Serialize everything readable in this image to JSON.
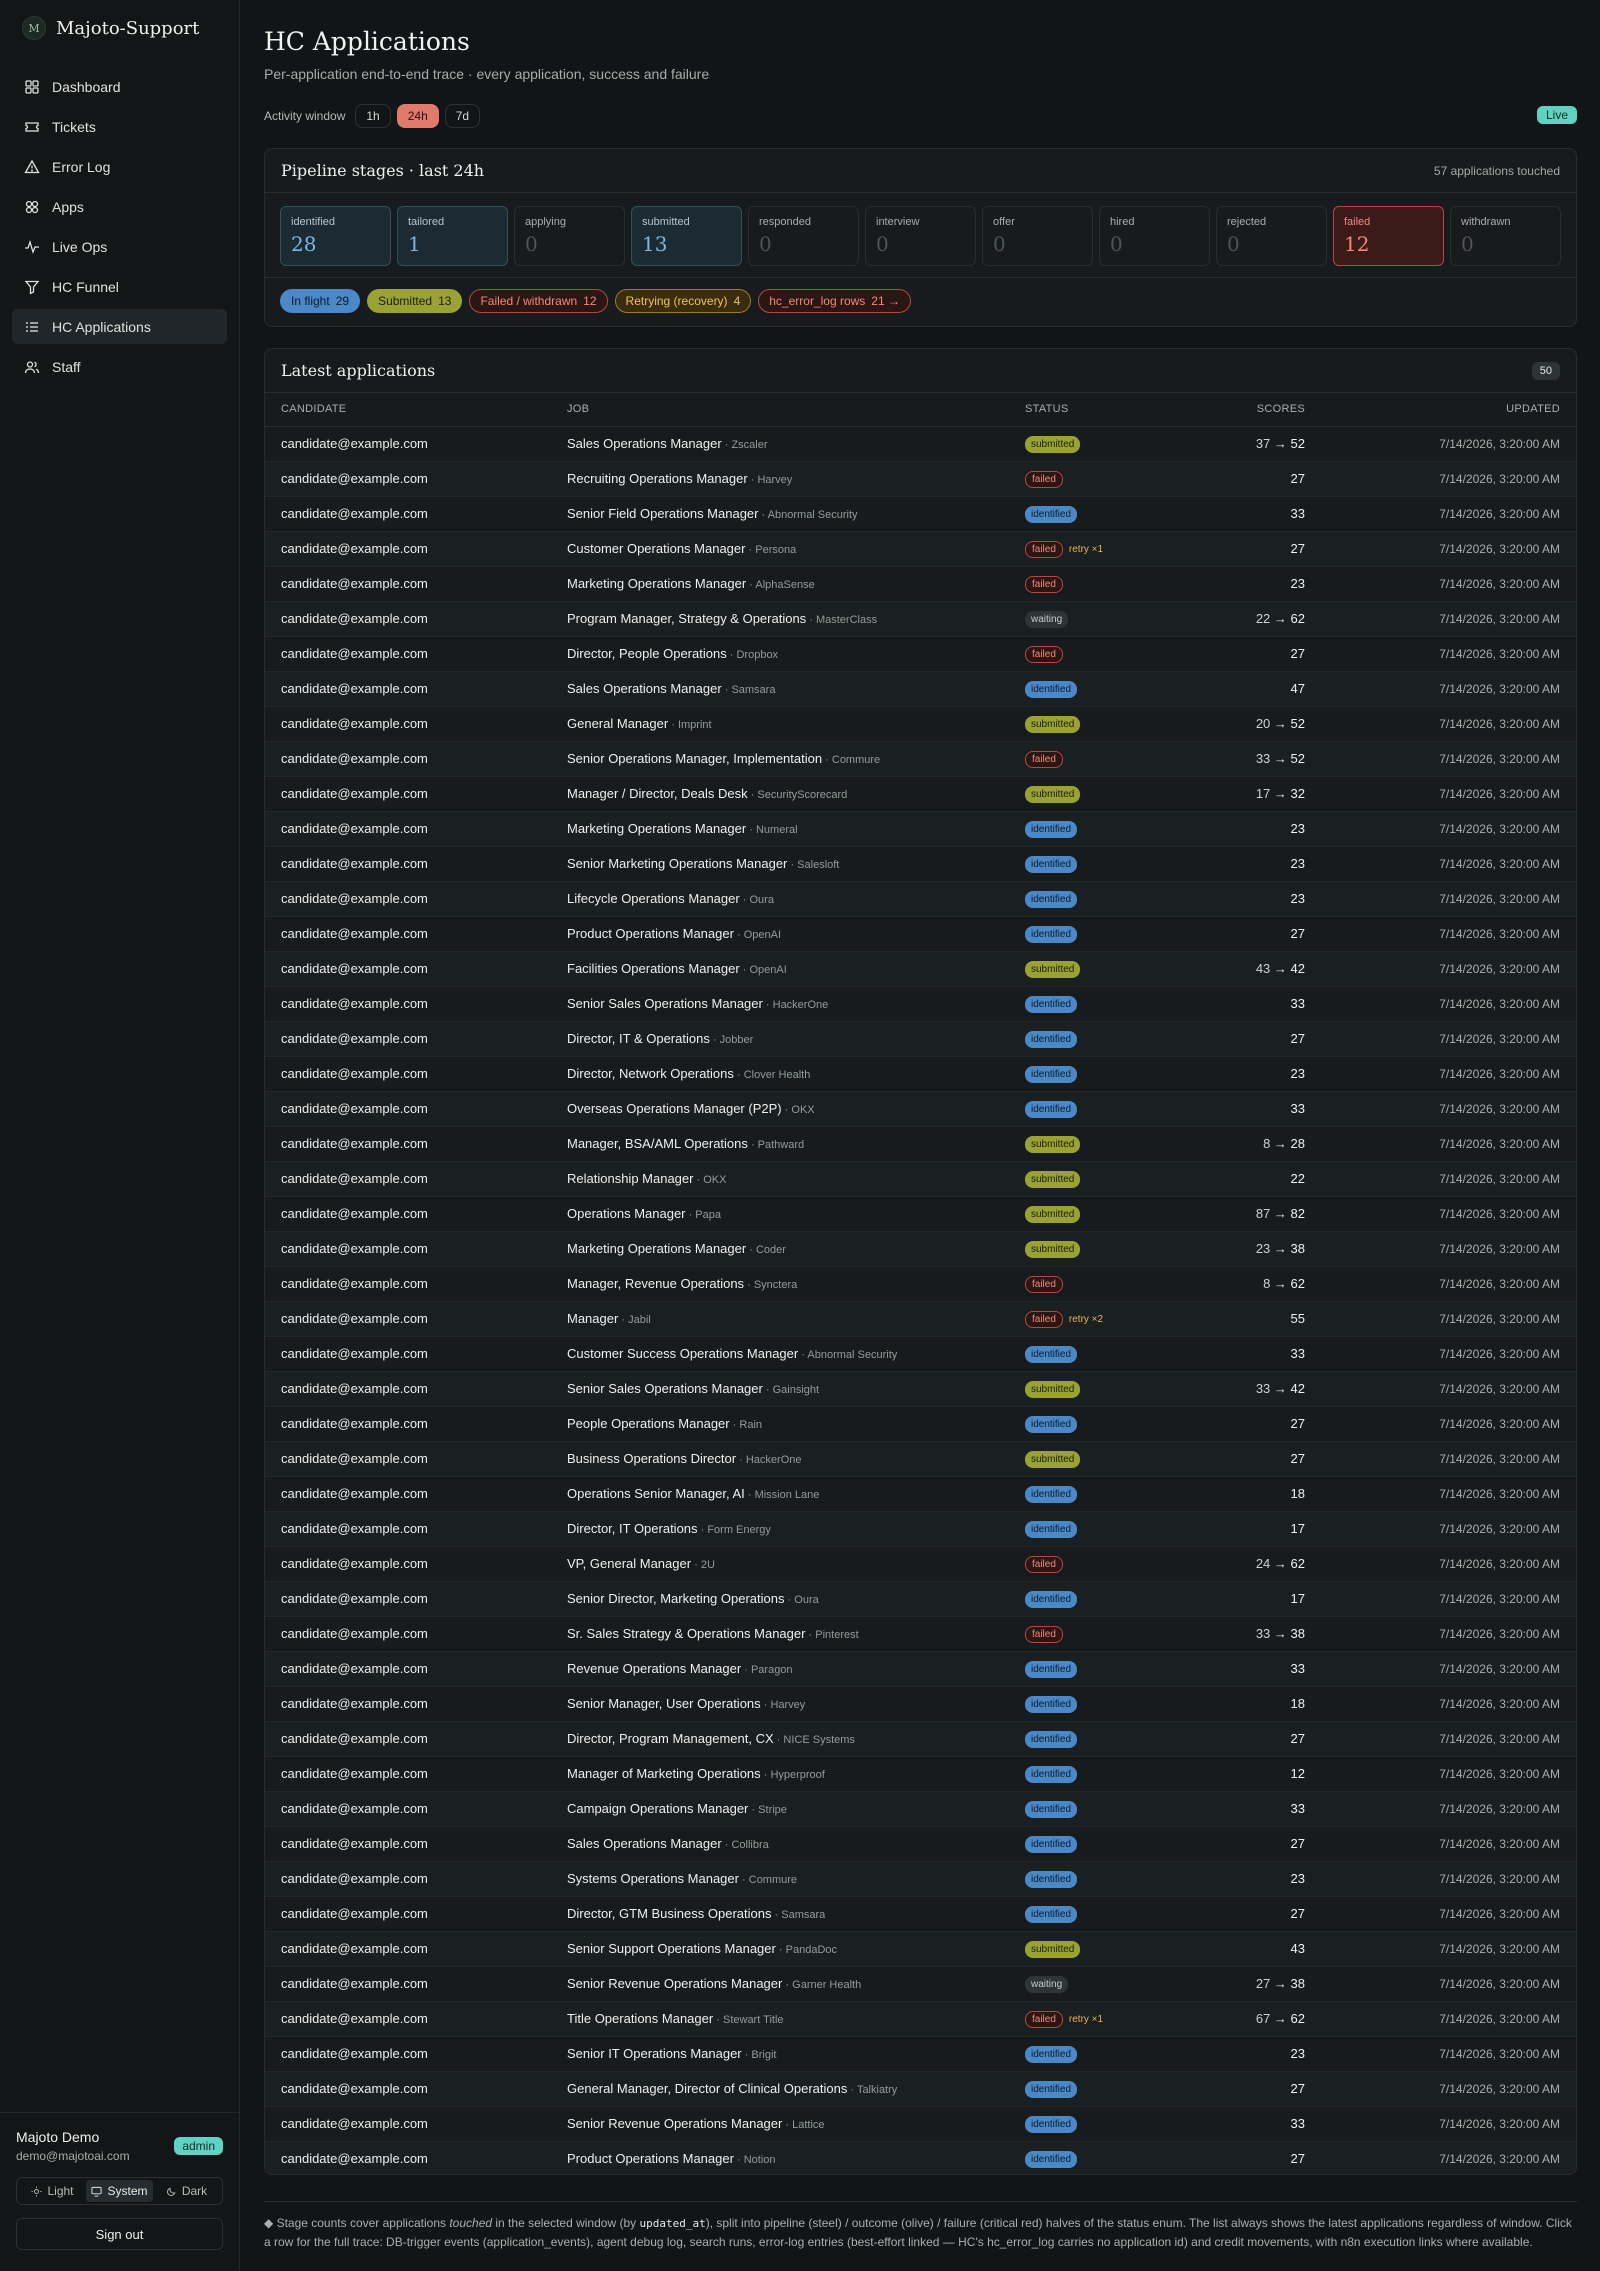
{
  "brand": {
    "logo_text": "M",
    "name": "Majoto-Support"
  },
  "nav": [
    {
      "label": "Dashboard",
      "icon": "dashboard-icon",
      "active": false
    },
    {
      "label": "Tickets",
      "icon": "ticket-icon",
      "active": false
    },
    {
      "label": "Error Log",
      "icon": "warning-icon",
      "active": false
    },
    {
      "label": "Apps",
      "icon": "apps-icon",
      "active": false
    },
    {
      "label": "Live Ops",
      "icon": "activity-icon",
      "active": false
    },
    {
      "label": "HC Funnel",
      "icon": "funnel-icon",
      "active": false
    },
    {
      "label": "HC Applications",
      "icon": "list-icon",
      "active": true
    },
    {
      "label": "Staff",
      "icon": "users-icon",
      "active": false
    }
  ],
  "user": {
    "name": "Majoto Demo",
    "email": "demo@majotoai.com",
    "role": "admin"
  },
  "theme": {
    "options": [
      "Light",
      "System",
      "Dark"
    ],
    "selected": "System"
  },
  "signout_label": "Sign out",
  "header": {
    "title": "HC Applications",
    "subtitle": "Per-application end-to-end trace · every application, success and failure",
    "window_label": "Activity window",
    "windows": [
      "1h",
      "24h",
      "7d"
    ],
    "window_selected": "24h",
    "live_label": "Live"
  },
  "pipeline": {
    "title": "Pipeline stages · last 24h",
    "meta": "57 applications touched",
    "stages": [
      {
        "label": "identified",
        "count": "28",
        "tone": "steel"
      },
      {
        "label": "tailored",
        "count": "1",
        "tone": "steel"
      },
      {
        "label": "applying",
        "count": "0",
        "tone": "muted"
      },
      {
        "label": "submitted",
        "count": "13",
        "tone": "steel"
      },
      {
        "label": "responded",
        "count": "0",
        "tone": "muted"
      },
      {
        "label": "interview",
        "count": "0",
        "tone": "muted"
      },
      {
        "label": "offer",
        "count": "0",
        "tone": "muted"
      },
      {
        "label": "hired",
        "count": "0",
        "tone": "muted"
      },
      {
        "label": "rejected",
        "count": "0",
        "tone": "muted"
      },
      {
        "label": "failed",
        "count": "12",
        "tone": "crit"
      },
      {
        "label": "withdrawn",
        "count": "0",
        "tone": "muted"
      }
    ],
    "chips": [
      {
        "label": "In flight",
        "count": "29",
        "tone": "blue"
      },
      {
        "label": "Submitted",
        "count": "13",
        "tone": "olive"
      },
      {
        "label": "Failed / withdrawn",
        "count": "12",
        "tone": "red"
      },
      {
        "label": "Retrying (recovery)",
        "count": "4",
        "tone": "amber"
      },
      {
        "label": "hc_error_log rows",
        "count": "21 →",
        "tone": "redlink"
      }
    ]
  },
  "applications": {
    "title": "Latest applications",
    "count": "50",
    "columns": [
      "CANDIDATE",
      "JOB",
      "STATUS",
      "SCORES",
      "UPDATED"
    ],
    "rows": [
      {
        "candidate": "candidate@example.com",
        "job": "Sales Operations Manager",
        "company": "Zscaler",
        "status": "submitted",
        "retry": "",
        "score_old": "37",
        "score_new": "52",
        "updated": "7/14/2026, 3:20:00 AM"
      },
      {
        "candidate": "candidate@example.com",
        "job": "Recruiting Operations Manager",
        "company": "Harvey",
        "status": "failed",
        "retry": "",
        "score_old": "",
        "score_new": "27",
        "updated": "7/14/2026, 3:20:00 AM"
      },
      {
        "candidate": "candidate@example.com",
        "job": "Senior Field Operations Manager",
        "company": "Abnormal Security",
        "status": "identified",
        "retry": "",
        "score_old": "",
        "score_new": "33",
        "updated": "7/14/2026, 3:20:00 AM"
      },
      {
        "candidate": "candidate@example.com",
        "job": "Customer Operations Manager",
        "company": "Persona",
        "status": "failed",
        "retry": "retry ×1",
        "score_old": "",
        "score_new": "27",
        "updated": "7/14/2026, 3:20:00 AM"
      },
      {
        "candidate": "candidate@example.com",
        "job": "Marketing Operations Manager",
        "company": "AlphaSense",
        "status": "failed",
        "retry": "",
        "score_old": "",
        "score_new": "23",
        "updated": "7/14/2026, 3:20:00 AM"
      },
      {
        "candidate": "candidate@example.com",
        "job": "Program Manager, Strategy & Operations",
        "company": "MasterClass",
        "status": "waiting",
        "retry": "",
        "score_old": "22",
        "score_new": "62",
        "updated": "7/14/2026, 3:20:00 AM"
      },
      {
        "candidate": "candidate@example.com",
        "job": "Director, People Operations",
        "company": "Dropbox",
        "status": "failed",
        "retry": "",
        "score_old": "",
        "score_new": "27",
        "updated": "7/14/2026, 3:20:00 AM"
      },
      {
        "candidate": "candidate@example.com",
        "job": "Sales Operations Manager",
        "company": "Samsara",
        "status": "identified",
        "retry": "",
        "score_old": "",
        "score_new": "47",
        "updated": "7/14/2026, 3:20:00 AM"
      },
      {
        "candidate": "candidate@example.com",
        "job": "General Manager",
        "company": "Imprint",
        "status": "submitted",
        "retry": "",
        "score_old": "20",
        "score_new": "52",
        "updated": "7/14/2026, 3:20:00 AM"
      },
      {
        "candidate": "candidate@example.com",
        "job": "Senior Operations Manager, Implementation",
        "company": "Commure",
        "status": "failed",
        "retry": "",
        "score_old": "33",
        "score_new": "52",
        "updated": "7/14/2026, 3:20:00 AM"
      },
      {
        "candidate": "candidate@example.com",
        "job": "Manager / Director, Deals Desk",
        "company": "SecurityScorecard",
        "status": "submitted",
        "retry": "",
        "score_old": "17",
        "score_new": "32",
        "updated": "7/14/2026, 3:20:00 AM"
      },
      {
        "candidate": "candidate@example.com",
        "job": "Marketing Operations Manager",
        "company": "Numeral",
        "status": "identified",
        "retry": "",
        "score_old": "",
        "score_new": "23",
        "updated": "7/14/2026, 3:20:00 AM"
      },
      {
        "candidate": "candidate@example.com",
        "job": "Senior Marketing Operations Manager",
        "company": "Salesloft",
        "status": "identified",
        "retry": "",
        "score_old": "",
        "score_new": "23",
        "updated": "7/14/2026, 3:20:00 AM"
      },
      {
        "candidate": "candidate@example.com",
        "job": "Lifecycle Operations Manager",
        "company": "Oura",
        "status": "identified",
        "retry": "",
        "score_old": "",
        "score_new": "23",
        "updated": "7/14/2026, 3:20:00 AM"
      },
      {
        "candidate": "candidate@example.com",
        "job": "Product Operations Manager",
        "company": "OpenAI",
        "status": "identified",
        "retry": "",
        "score_old": "",
        "score_new": "27",
        "updated": "7/14/2026, 3:20:00 AM"
      },
      {
        "candidate": "candidate@example.com",
        "job": "Facilities Operations Manager",
        "company": "OpenAI",
        "status": "submitted",
        "retry": "",
        "score_old": "43",
        "score_new": "42",
        "updated": "7/14/2026, 3:20:00 AM"
      },
      {
        "candidate": "candidate@example.com",
        "job": "Senior Sales Operations Manager",
        "company": "HackerOne",
        "status": "identified",
        "retry": "",
        "score_old": "",
        "score_new": "33",
        "updated": "7/14/2026, 3:20:00 AM"
      },
      {
        "candidate": "candidate@example.com",
        "job": "Director, IT & Operations",
        "company": "Jobber",
        "status": "identified",
        "retry": "",
        "score_old": "",
        "score_new": "27",
        "updated": "7/14/2026, 3:20:00 AM"
      },
      {
        "candidate": "candidate@example.com",
        "job": "Director, Network Operations",
        "company": "Clover Health",
        "status": "identified",
        "retry": "",
        "score_old": "",
        "score_new": "23",
        "updated": "7/14/2026, 3:20:00 AM"
      },
      {
        "candidate": "candidate@example.com",
        "job": "Overseas Operations Manager (P2P)",
        "company": "OKX",
        "status": "identified",
        "retry": "",
        "score_old": "",
        "score_new": "33",
        "updated": "7/14/2026, 3:20:00 AM"
      },
      {
        "candidate": "candidate@example.com",
        "job": "Manager, BSA/AML Operations",
        "company": "Pathward",
        "status": "submitted",
        "retry": "",
        "score_old": "8",
        "score_new": "28",
        "updated": "7/14/2026, 3:20:00 AM"
      },
      {
        "candidate": "candidate@example.com",
        "job": "Relationship Manager",
        "company": "OKX",
        "status": "submitted",
        "retry": "",
        "score_old": "",
        "score_new": "22",
        "updated": "7/14/2026, 3:20:00 AM"
      },
      {
        "candidate": "candidate@example.com",
        "job": "Operations Manager",
        "company": "Papa",
        "status": "submitted",
        "retry": "",
        "score_old": "87",
        "score_new": "82",
        "updated": "7/14/2026, 3:20:00 AM"
      },
      {
        "candidate": "candidate@example.com",
        "job": "Marketing Operations Manager",
        "company": "Coder",
        "status": "submitted",
        "retry": "",
        "score_old": "23",
        "score_new": "38",
        "updated": "7/14/2026, 3:20:00 AM"
      },
      {
        "candidate": "candidate@example.com",
        "job": "Manager, Revenue Operations",
        "company": "Synctera",
        "status": "failed",
        "retry": "",
        "score_old": "8",
        "score_new": "62",
        "updated": "7/14/2026, 3:20:00 AM"
      },
      {
        "candidate": "candidate@example.com",
        "job": "Manager",
        "company": "Jabil",
        "status": "failed",
        "retry": "retry ×2",
        "score_old": "",
        "score_new": "55",
        "updated": "7/14/2026, 3:20:00 AM"
      },
      {
        "candidate": "candidate@example.com",
        "job": "Customer Success Operations Manager",
        "company": "Abnormal Security",
        "status": "identified",
        "retry": "",
        "score_old": "",
        "score_new": "33",
        "updated": "7/14/2026, 3:20:00 AM"
      },
      {
        "candidate": "candidate@example.com",
        "job": "Senior Sales Operations Manager",
        "company": "Gainsight",
        "status": "submitted",
        "retry": "",
        "score_old": "33",
        "score_new": "42",
        "updated": "7/14/2026, 3:20:00 AM"
      },
      {
        "candidate": "candidate@example.com",
        "job": "People Operations Manager",
        "company": "Rain",
        "status": "identified",
        "retry": "",
        "score_old": "",
        "score_new": "27",
        "updated": "7/14/2026, 3:20:00 AM"
      },
      {
        "candidate": "candidate@example.com",
        "job": "Business Operations Director",
        "company": "HackerOne",
        "status": "submitted",
        "retry": "",
        "score_old": "",
        "score_new": "27",
        "updated": "7/14/2026, 3:20:00 AM"
      },
      {
        "candidate": "candidate@example.com",
        "job": "Operations Senior Manager, AI",
        "company": "Mission Lane",
        "status": "identified",
        "retry": "",
        "score_old": "",
        "score_new": "18",
        "updated": "7/14/2026, 3:20:00 AM"
      },
      {
        "candidate": "candidate@example.com",
        "job": "Director, IT Operations",
        "company": "Form Energy",
        "status": "identified",
        "retry": "",
        "score_old": "",
        "score_new": "17",
        "updated": "7/14/2026, 3:20:00 AM"
      },
      {
        "candidate": "candidate@example.com",
        "job": "VP, General Manager",
        "company": "2U",
        "status": "failed",
        "retry": "",
        "score_old": "24",
        "score_new": "62",
        "updated": "7/14/2026, 3:20:00 AM"
      },
      {
        "candidate": "candidate@example.com",
        "job": "Senior Director, Marketing Operations",
        "company": "Oura",
        "status": "identified",
        "retry": "",
        "score_old": "",
        "score_new": "17",
        "updated": "7/14/2026, 3:20:00 AM"
      },
      {
        "candidate": "candidate@example.com",
        "job": "Sr. Sales Strategy & Operations Manager",
        "company": "Pinterest",
        "status": "failed",
        "retry": "",
        "score_old": "33",
        "score_new": "38",
        "updated": "7/14/2026, 3:20:00 AM"
      },
      {
        "candidate": "candidate@example.com",
        "job": "Revenue Operations Manager",
        "company": "Paragon",
        "status": "identified",
        "retry": "",
        "score_old": "",
        "score_new": "33",
        "updated": "7/14/2026, 3:20:00 AM"
      },
      {
        "candidate": "candidate@example.com",
        "job": "Senior Manager, User Operations",
        "company": "Harvey",
        "status": "identified",
        "retry": "",
        "score_old": "",
        "score_new": "18",
        "updated": "7/14/2026, 3:20:00 AM"
      },
      {
        "candidate": "candidate@example.com",
        "job": "Director, Program Management, CX",
        "company": "NICE Systems",
        "status": "identified",
        "retry": "",
        "score_old": "",
        "score_new": "27",
        "updated": "7/14/2026, 3:20:00 AM"
      },
      {
        "candidate": "candidate@example.com",
        "job": "Manager of Marketing Operations",
        "company": "Hyperproof",
        "status": "identified",
        "retry": "",
        "score_old": "",
        "score_new": "12",
        "updated": "7/14/2026, 3:20:00 AM"
      },
      {
        "candidate": "candidate@example.com",
        "job": "Campaign Operations Manager",
        "company": "Stripe",
        "status": "identified",
        "retry": "",
        "score_old": "",
        "score_new": "33",
        "updated": "7/14/2026, 3:20:00 AM"
      },
      {
        "candidate": "candidate@example.com",
        "job": "Sales Operations Manager",
        "company": "Collibra",
        "status": "identified",
        "retry": "",
        "score_old": "",
        "score_new": "27",
        "updated": "7/14/2026, 3:20:00 AM"
      },
      {
        "candidate": "candidate@example.com",
        "job": "Systems Operations Manager",
        "company": "Commure",
        "status": "identified",
        "retry": "",
        "score_old": "",
        "score_new": "23",
        "updated": "7/14/2026, 3:20:00 AM"
      },
      {
        "candidate": "candidate@example.com",
        "job": "Director, GTM Business Operations",
        "company": "Samsara",
        "status": "identified",
        "retry": "",
        "score_old": "",
        "score_new": "27",
        "updated": "7/14/2026, 3:20:00 AM"
      },
      {
        "candidate": "candidate@example.com",
        "job": "Senior Support Operations Manager",
        "company": "PandaDoc",
        "status": "submitted",
        "retry": "",
        "score_old": "",
        "score_new": "43",
        "updated": "7/14/2026, 3:20:00 AM"
      },
      {
        "candidate": "candidate@example.com",
        "job": "Senior Revenue Operations Manager",
        "company": "Garner Health",
        "status": "waiting",
        "retry": "",
        "score_old": "27",
        "score_new": "38",
        "updated": "7/14/2026, 3:20:00 AM"
      },
      {
        "candidate": "candidate@example.com",
        "job": "Title Operations Manager",
        "company": "Stewart Title",
        "status": "failed",
        "retry": "retry ×1",
        "score_old": "67",
        "score_new": "62",
        "updated": "7/14/2026, 3:20:00 AM"
      },
      {
        "candidate": "candidate@example.com",
        "job": "Senior IT Operations Manager",
        "company": "Brigit",
        "status": "identified",
        "retry": "",
        "score_old": "",
        "score_new": "23",
        "updated": "7/14/2026, 3:20:00 AM"
      },
      {
        "candidate": "candidate@example.com",
        "job": "General Manager, Director of Clinical Operations",
        "company": "Talkiatry",
        "status": "identified",
        "retry": "",
        "score_old": "",
        "score_new": "27",
        "updated": "7/14/2026, 3:20:00 AM"
      },
      {
        "candidate": "candidate@example.com",
        "job": "Senior Revenue Operations Manager",
        "company": "Lattice",
        "status": "identified",
        "retry": "",
        "score_old": "",
        "score_new": "33",
        "updated": "7/14/2026, 3:20:00 AM"
      },
      {
        "candidate": "candidate@example.com",
        "job": "Product Operations Manager",
        "company": "Notion",
        "status": "identified",
        "retry": "",
        "score_old": "",
        "score_new": "27",
        "updated": "7/14/2026, 3:20:00 AM"
      }
    ]
  },
  "footnote": {
    "lead": "◆ Stage counts cover applications ",
    "em": "touched",
    "mid": " in the selected window (by ",
    "code": "updated_at",
    "tail": "), split into pipeline (steel) / outcome (olive) / failure (critical red) halves of the status enum. The list always shows the latest applications regardless of window. Click a row for the full trace: DB-trigger events (application_events), agent debug log, search runs, error-log entries (best-effort linked — HC's hc_error_log carries no application id) and credit movements, with n8n execution links where available."
  }
}
